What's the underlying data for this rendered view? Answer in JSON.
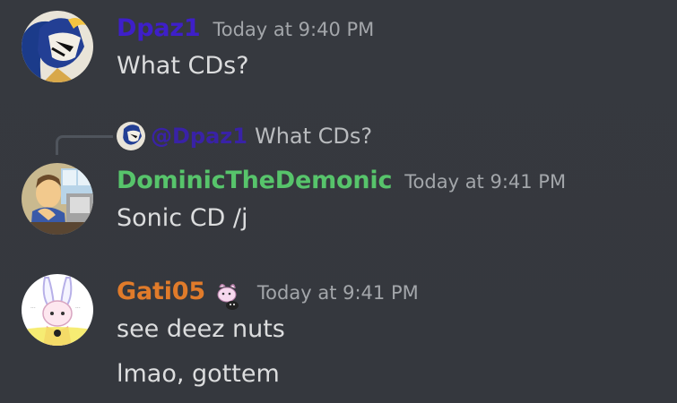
{
  "messages": [
    {
      "username": "Dpaz1",
      "username_color": "#3e1fc9",
      "timestamp": "Today at 9:40 PM",
      "avatar_icon": "anime-character-avatar-icon",
      "lines": [
        "What CDs?"
      ]
    },
    {
      "reply": {
        "mention": "@Dpaz1",
        "text": "What CDs?"
      },
      "username": "DominicTheDemonic",
      "username_color": "#57c46b",
      "timestamp": "Today at 9:41 PM",
      "avatar_icon": "cartoon-man-avatar-icon",
      "lines": [
        "Sonic CD /j"
      ]
    },
    {
      "username": "Gati05",
      "username_color": "#e07b2a",
      "timestamp": "Today at 9:41 PM",
      "avatar_icon": "bunny-character-avatar-icon",
      "badge_icon": "pet-badge-icon",
      "lines": [
        "see deez nuts",
        "lmao, gottem"
      ]
    }
  ]
}
